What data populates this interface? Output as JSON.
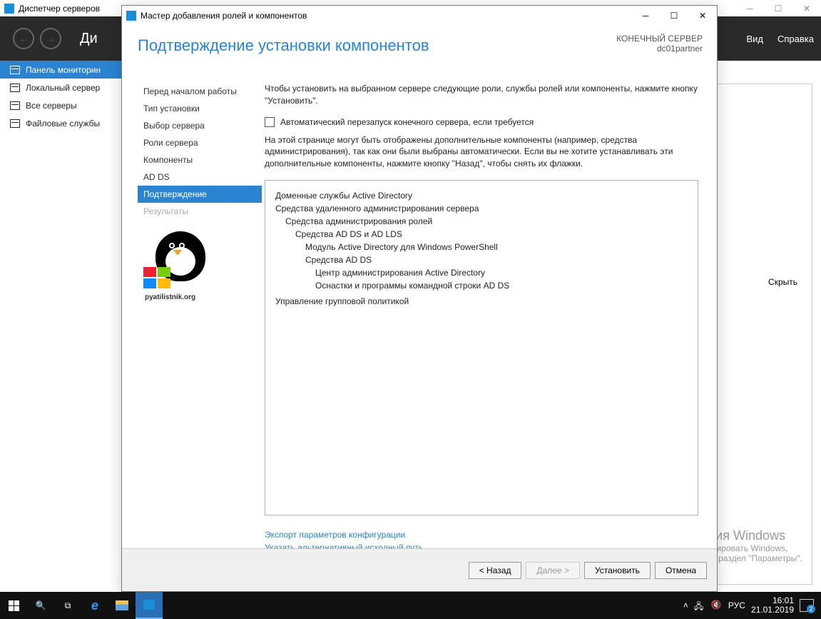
{
  "bg": {
    "title": "Диспетчер серверов",
    "breadcrumb": "Ди",
    "menu": [
      "Вид",
      "Справка"
    ],
    "sidebar": [
      {
        "label": "Панель мониторин",
        "active": true
      },
      {
        "label": "Локальный сервер"
      },
      {
        "label": "Все серверы"
      },
      {
        "label": "Файловые службы"
      }
    ],
    "hide": "Скрыть"
  },
  "wizard": {
    "title": "Мастер добавления ролей и компонентов",
    "heading": "Подтверждение установки компонентов",
    "target_label": "КОНЕЧНЫЙ СЕРВЕР",
    "target_server": "dc01partner",
    "steps": [
      {
        "label": "Перед началом работы"
      },
      {
        "label": "Тип установки"
      },
      {
        "label": "Выбор сервера"
      },
      {
        "label": "Роли сервера"
      },
      {
        "label": "Компоненты"
      },
      {
        "label": "AD DS"
      },
      {
        "label": "Подтверждение",
        "selected": true
      },
      {
        "label": "Результаты",
        "disabled": true
      }
    ],
    "logo_url": "pyatilistnik.org",
    "intro": "Чтобы установить на выбранном сервере следующие роли, службы ролей или компоненты, нажмите кнопку \"Установить\".",
    "checkbox": "Автоматический перезапуск конечного сервера, если требуется",
    "note": "На этой странице могут быть отображены дополнительные компоненты (например, средства администрирования), так как они были выбраны автоматически. Если вы не хотите устанавливать эти дополнительные компоненты, нажмите кнопку \"Назад\", чтобы снять их флажки.",
    "tree": [
      {
        "t": "Доменные службы Active Directory",
        "lv": 0
      },
      {
        "t": "Средства удаленного администрирования сервера",
        "lv": 0
      },
      {
        "t": "Средства администрирования ролей",
        "lv": 1
      },
      {
        "t": "Средства AD DS и AD LDS",
        "lv": 2
      },
      {
        "t": "Модуль Active Directory для Windows PowerShell",
        "lv": 3
      },
      {
        "t": "Средства AD DS",
        "lv": 3
      },
      {
        "t": "Центр администрирования Active Directory",
        "lv": 4
      },
      {
        "t": "Оснастки и программы командной строки AD DS",
        "lv": 4
      },
      {
        "t": "",
        "lv": 0
      },
      {
        "t": "Управление групповой политикой",
        "lv": 0
      }
    ],
    "links": [
      "Экспорт параметров конфигурации",
      "Указать альтернативный исходный путь"
    ],
    "buttons": {
      "back": "< Назад",
      "next": "Далее >",
      "install": "Установить",
      "cancel": "Отмена"
    }
  },
  "watermark": {
    "title": "Активация Windows",
    "sub1": "Чтобы активировать Windows,",
    "sub2": "перейдите в раздел \"Параметры\"."
  },
  "taskbar": {
    "lang": "РУС",
    "time": "16:01",
    "date": "21.01.2019",
    "notif_count": "2"
  }
}
